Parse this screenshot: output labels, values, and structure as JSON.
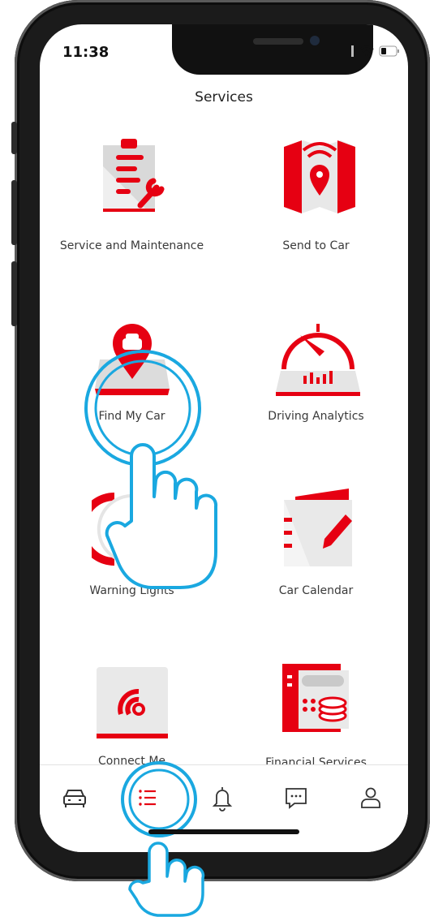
{
  "status_bar": {
    "time": "11:38"
  },
  "header": {
    "title": "Services"
  },
  "services": [
    {
      "label": "Service and Maintenance",
      "icon": "clipboard-wrench-icon"
    },
    {
      "label": "Send to Car",
      "icon": "map-pin-signal-icon"
    },
    {
      "label": "Find My Car",
      "icon": "car-location-pin-icon"
    },
    {
      "label": "Driving Analytics",
      "icon": "speedometer-chart-icon"
    },
    {
      "label": "Warning Lights",
      "icon": "dashboard-gauge-icon"
    },
    {
      "label": "Car Calendar",
      "icon": "calendar-notebook-icon"
    },
    {
      "label": "Connect Me",
      "icon": "connect-signal-icon"
    },
    {
      "label": "Financial Services",
      "icon": "finance-coins-icon"
    }
  ],
  "tabbar": [
    {
      "name": "car-tab",
      "icon": "car-icon"
    },
    {
      "name": "services-tab",
      "icon": "list-icon",
      "active": true
    },
    {
      "name": "notifications-tab",
      "icon": "bell-icon"
    },
    {
      "name": "messages-tab",
      "icon": "chat-icon"
    },
    {
      "name": "profile-tab",
      "icon": "user-icon"
    }
  ],
  "colors": {
    "accent": "#e60012",
    "tap_highlight": "#1aa8e0",
    "text": "#3a3a3a"
  }
}
